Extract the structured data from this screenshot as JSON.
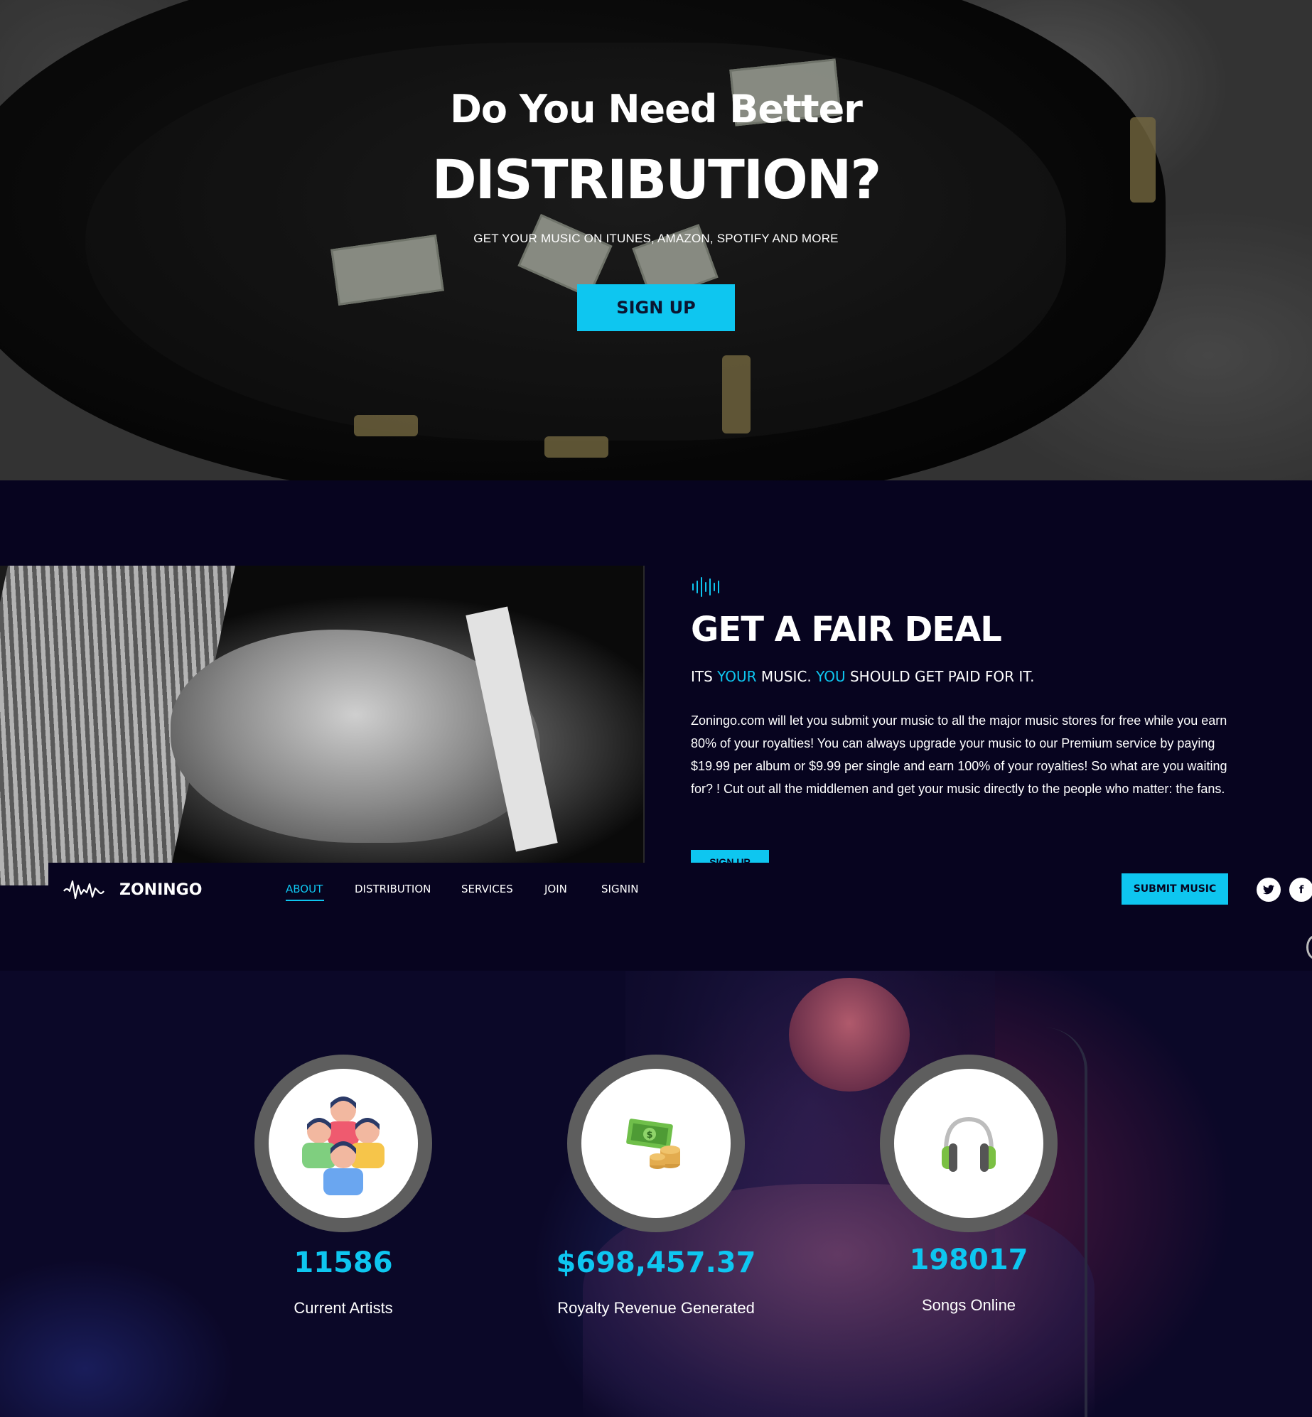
{
  "hero": {
    "title_line1": "Do You Need Better",
    "title_line2": "DISTRIBUTION?",
    "subtitle": "GET YOUR MUSIC ON ITUNES, AMAZON, SPOTIFY AND MORE",
    "cta_label": "SIGN UP"
  },
  "deal": {
    "icon": "sound-wave-icon",
    "title": "GET A FAIR DEAL",
    "sub_part1": "ITS ",
    "sub_hl1": "YOUR",
    "sub_part2": " MUSIC. ",
    "sub_hl2": "YOU",
    "sub_part3": " SHOULD GET PAID FOR IT.",
    "body": "Zoningo.com will let you submit your music to all the major music stores for free while you earn 80% of your royalties! You can always upgrade your music to our Premium service by paying $19.99 per album or $9.99 per single and earn 100% of your royalties! So what are you waiting for? ! Cut out all the middlemen and get your music directly to the people who matter: the fans.",
    "cta_label": "SIGN UP"
  },
  "nav": {
    "brand": "ZONINGO",
    "logo_icon": "waveform-logo-icon",
    "items": [
      {
        "label": "ABOUT",
        "active": true
      },
      {
        "label": "DISTRIBUTION",
        "active": false
      },
      {
        "label": "SERVICES",
        "active": false
      },
      {
        "label": "JOIN",
        "active": false
      },
      {
        "label": "SIGNIN",
        "active": false
      }
    ],
    "submit_label": "SUBMIT MUSIC",
    "social": [
      {
        "icon": "twitter-icon",
        "glyph": "🐦"
      },
      {
        "icon": "facebook-icon",
        "glyph": "f"
      }
    ]
  },
  "stats": [
    {
      "value": "11586",
      "label": "Current Artists",
      "icon": "people-group-icon"
    },
    {
      "value": "$698,457.37",
      "label": "Royalty Revenue Generated",
      "icon": "money-coins-icon"
    },
    {
      "value": "198017",
      "label": "Songs Online",
      "icon": "headphones-icon"
    }
  ],
  "colors": {
    "accent": "#0ec6f0",
    "background": "#07041f",
    "ring": "#5e5e5e"
  }
}
